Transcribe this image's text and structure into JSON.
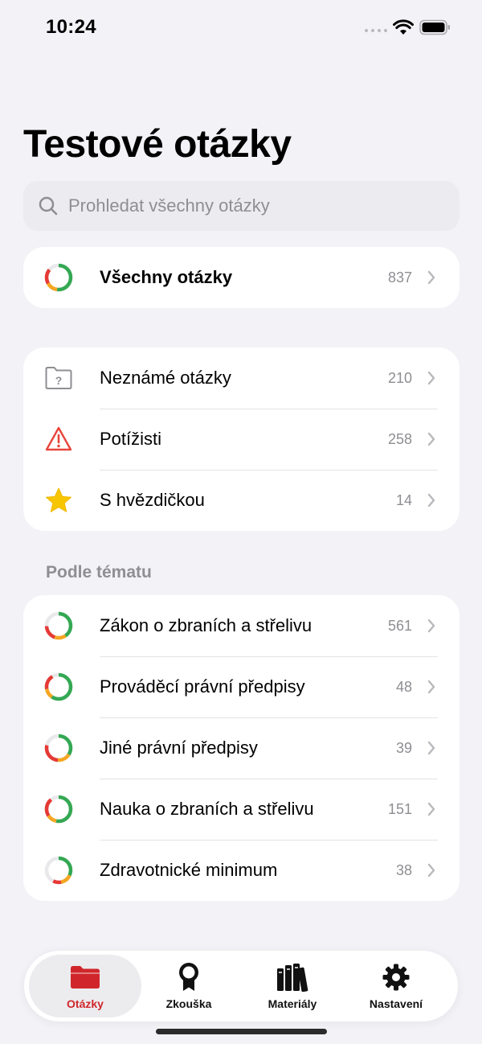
{
  "status_bar": {
    "time": "10:24"
  },
  "header": {
    "title": "Testové otázky"
  },
  "search": {
    "placeholder": "Prohledat všechny otázky"
  },
  "all_questions": {
    "label": "Všechny otázky",
    "count": "837"
  },
  "filters": [
    {
      "label": "Neznámé otázky",
      "count": "210",
      "icon": "folder-question-icon"
    },
    {
      "label": "Potížisti",
      "count": "258",
      "icon": "warning-icon"
    },
    {
      "label": "S hvězdičkou",
      "count": "14",
      "icon": "star-icon"
    }
  ],
  "topics_section": {
    "header": "Podle tématu",
    "items": [
      {
        "label": "Zákon o zbraních a střelivu",
        "count": "561"
      },
      {
        "label": "Prováděcí právní předpisy",
        "count": "48"
      },
      {
        "label": "Jiné právní předpisy",
        "count": "39"
      },
      {
        "label": "Nauka o zbraních a střelivu",
        "count": "151"
      },
      {
        "label": "Zdravotnické minimum",
        "count": "38"
      }
    ]
  },
  "tabbar": {
    "tabs": [
      {
        "label": "Otázky",
        "icon": "folder-icon",
        "active": true
      },
      {
        "label": "Zkouška",
        "icon": "award-icon",
        "active": false
      },
      {
        "label": "Materiály",
        "icon": "books-icon",
        "active": false
      },
      {
        "label": "Nastavení",
        "icon": "gear-icon",
        "active": false
      }
    ]
  },
  "colors": {
    "accent": "#d0262b",
    "progress_green": "#34a853",
    "progress_orange": "#f5a623",
    "progress_red": "#e53935",
    "warning": "#e8453c",
    "star": "#f7c600",
    "background": "#f2f2f7"
  }
}
